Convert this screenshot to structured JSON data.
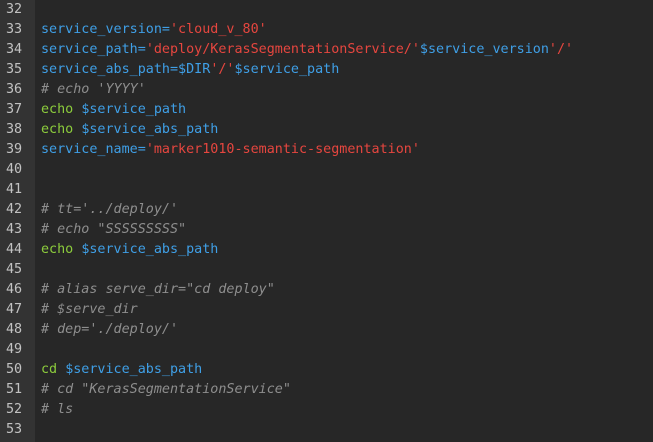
{
  "editor": {
    "language": "shell",
    "colors": {
      "background": "#272727",
      "gutter": "#333333",
      "line_number": "#c2c2c2",
      "variable": "#3f9fe6",
      "string": "#e6463f",
      "comment": "#8e8e8e",
      "keyword": "#8ccc3c"
    },
    "lines": [
      {
        "n": "32",
        "tokens": []
      },
      {
        "n": "33",
        "tokens": [
          {
            "t": "var",
            "v": "service_version="
          },
          {
            "t": "str",
            "v": "'cloud_v_80'"
          }
        ]
      },
      {
        "n": "34",
        "tokens": [
          {
            "t": "var",
            "v": "service_path="
          },
          {
            "t": "str",
            "v": "'deploy/KerasSegmentationService/'"
          },
          {
            "t": "var",
            "v": "$service_version"
          },
          {
            "t": "str",
            "v": "'/'"
          }
        ]
      },
      {
        "n": "35",
        "tokens": [
          {
            "t": "var",
            "v": "service_abs_path=$DIR"
          },
          {
            "t": "str",
            "v": "'/'"
          },
          {
            "t": "var",
            "v": "$service_path"
          }
        ]
      },
      {
        "n": "36",
        "tokens": [
          {
            "t": "cmt",
            "v": "# echo 'YYYY'"
          }
        ]
      },
      {
        "n": "37",
        "tokens": [
          {
            "t": "kw",
            "v": "echo "
          },
          {
            "t": "var",
            "v": "$service_path"
          }
        ]
      },
      {
        "n": "38",
        "tokens": [
          {
            "t": "kw",
            "v": "echo "
          },
          {
            "t": "var",
            "v": "$service_abs_path"
          }
        ]
      },
      {
        "n": "39",
        "tokens": [
          {
            "t": "var",
            "v": "service_name="
          },
          {
            "t": "str",
            "v": "'marker1010-semantic-segmentation'"
          }
        ]
      },
      {
        "n": "40",
        "tokens": []
      },
      {
        "n": "41",
        "tokens": []
      },
      {
        "n": "42",
        "tokens": [
          {
            "t": "cmt",
            "v": "# tt='../deploy/'"
          }
        ]
      },
      {
        "n": "43",
        "tokens": [
          {
            "t": "cmt",
            "v": "# echo \"SSSSSSSSS\""
          }
        ]
      },
      {
        "n": "44",
        "tokens": [
          {
            "t": "kw",
            "v": "echo "
          },
          {
            "t": "var",
            "v": "$service_abs_path"
          }
        ]
      },
      {
        "n": "45",
        "tokens": []
      },
      {
        "n": "46",
        "tokens": [
          {
            "t": "cmt",
            "v": "# alias serve_dir=\"cd deploy\""
          }
        ]
      },
      {
        "n": "47",
        "tokens": [
          {
            "t": "cmt",
            "v": "# $serve_dir"
          }
        ]
      },
      {
        "n": "48",
        "tokens": [
          {
            "t": "cmt",
            "v": "# dep='./deploy/'"
          }
        ]
      },
      {
        "n": "49",
        "tokens": []
      },
      {
        "n": "50",
        "tokens": [
          {
            "t": "kw",
            "v": "cd "
          },
          {
            "t": "var",
            "v": "$service_abs_path"
          }
        ]
      },
      {
        "n": "51",
        "tokens": [
          {
            "t": "cmt",
            "v": "# cd \"KerasSegmentationService\""
          }
        ]
      },
      {
        "n": "52",
        "tokens": [
          {
            "t": "cmt",
            "v": "# ls"
          }
        ]
      },
      {
        "n": "53",
        "tokens": []
      }
    ]
  }
}
